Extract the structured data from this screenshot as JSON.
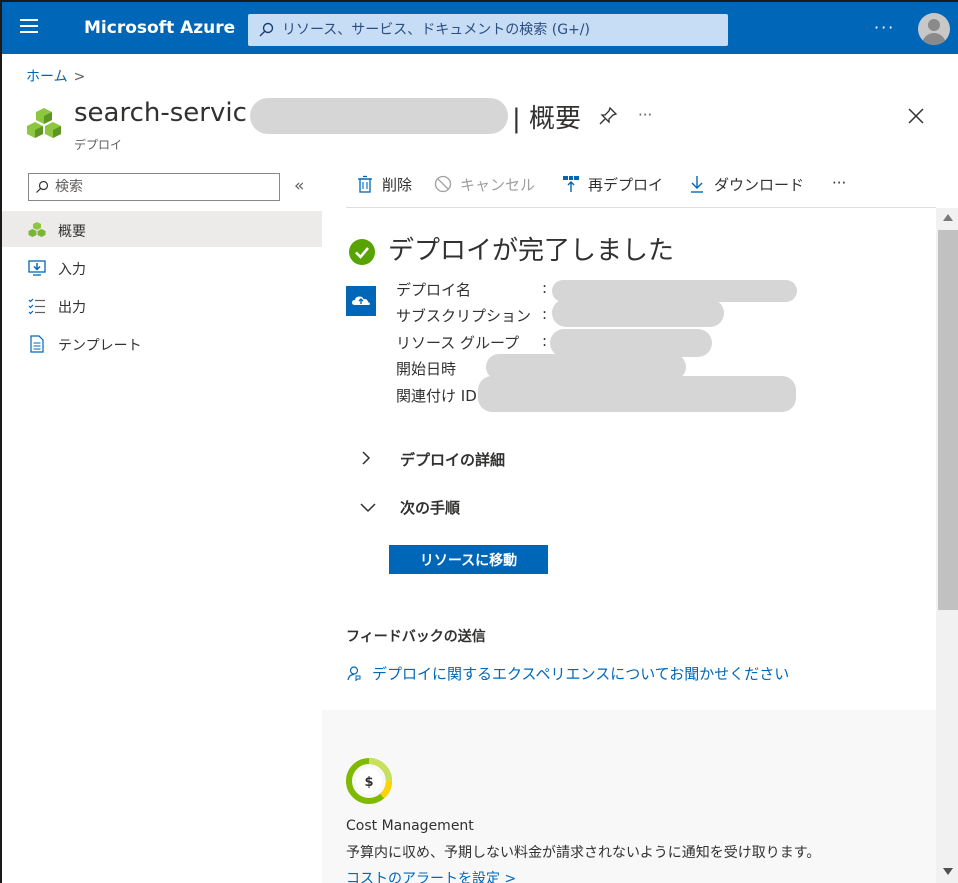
{
  "topbar": {
    "brand": "Microsoft Azure",
    "search_placeholder": "リソース、サービス、ドキュメントの検索 (G+/)",
    "more": "···",
    "accent": "#0067b8"
  },
  "breadcrumb": {
    "home": "ホーム",
    "separator": ">"
  },
  "header": {
    "title_prefix": "search-servic",
    "title_suffix": "| 概要",
    "subtitle": "デプロイ",
    "more": "···"
  },
  "nav": {
    "search_placeholder": "検索",
    "collapse": "«",
    "items": [
      {
        "label": "概要",
        "icon": "deployment-icon",
        "active": true
      },
      {
        "label": "入力",
        "icon": "input-icon",
        "active": false
      },
      {
        "label": "出力",
        "icon": "output-icon",
        "active": false
      },
      {
        "label": "テンプレート",
        "icon": "template-icon",
        "active": false
      }
    ]
  },
  "toolbar": {
    "delete": "削除",
    "cancel": "キャンセル",
    "redeploy": "再デプロイ",
    "download": "ダウンロード",
    "more": "···"
  },
  "status": {
    "title": "デプロイが完了しました",
    "properties": [
      {
        "label": "デプロイ名"
      },
      {
        "label": "サブスクリプション"
      },
      {
        "label": "リソース グループ"
      },
      {
        "label": "開始日時"
      },
      {
        "label": "関連付け ID"
      }
    ],
    "colon": ":"
  },
  "sections": {
    "details": "デプロイの詳細",
    "next_steps": "次の手順",
    "goto_button": "リソースに移動"
  },
  "feedback": {
    "title": "フィードバックの送信",
    "link": "デプロイに関するエクスペリエンスについてお聞かせください"
  },
  "cost": {
    "title": "Cost Management",
    "description": "予算内に収め、予期しない料金が請求されないように通知を受け取ります。",
    "link": "コストのアラートを設定 >"
  }
}
